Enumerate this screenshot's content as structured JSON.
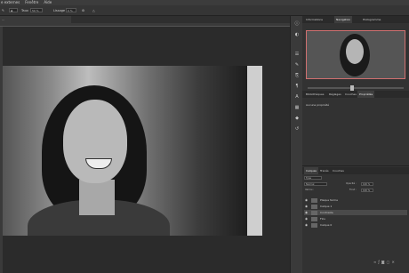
{
  "menubar": {
    "items": [
      "e externes",
      "Fenêtre",
      "Aide"
    ]
  },
  "options_bar": {
    "size_label": "Taux",
    "size_value": "50 %",
    "lissage_label": "Lissage :",
    "lissage_value": "0 %"
  },
  "document": {
    "tab_title": "...",
    "description": "Portrait photo"
  },
  "right_panel": {
    "top_tabs": [
      "Informations",
      "Navigation",
      "Histogramme"
    ],
    "active_top_tab": "Navigation",
    "mid_tabs": [
      "Bibliothèques",
      "Réglages",
      "Couches",
      "Propriétés"
    ],
    "active_mid_tab": "Propriétés",
    "properties_text": "Aucune propriété",
    "layers_tabs": [
      "Calques",
      "Tracés",
      "Couches"
    ],
    "active_layers_tab": "Calques",
    "kind_filter": "Type",
    "blend_mode": "Normal",
    "opacity_label": "Opacité :",
    "opacity_value": "100 %",
    "lock_label": "Verrou :",
    "fill_label": "Fond :",
    "fill_value": "100 %",
    "layers": [
      {
        "name": "Plaque ferme",
        "selected": false
      },
      {
        "name": "Calque 1",
        "selected": false
      },
      {
        "name": "Contraste",
        "selected": true
      },
      {
        "name": "Flou",
        "selected": false
      },
      {
        "name": "Calque 0",
        "selected": false
      }
    ]
  },
  "tools": [
    "move-icon",
    "marquee-icon",
    "lasso-icon",
    "crop-icon",
    "eyedropper-icon",
    "brush-icon",
    "stamp-icon",
    "history-brush-icon",
    "eraser-icon",
    "gradient-icon",
    "blur-icon",
    "dodge-icon",
    "pen-icon",
    "text-icon",
    "path-select-icon",
    "shape-icon",
    "hand-icon",
    "zoom-icon"
  ]
}
